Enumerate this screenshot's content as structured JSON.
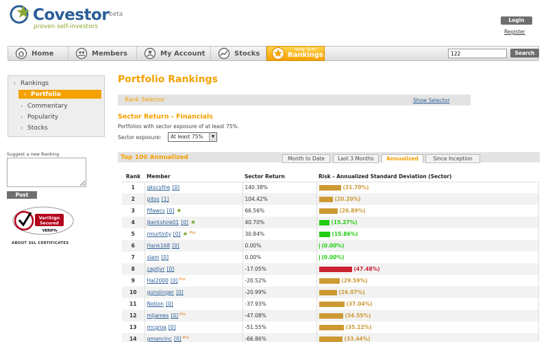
{
  "header": {
    "logo_name": "Covestor",
    "logo_beta": "beta",
    "tagline": "proven self-investors",
    "login_label": "Login",
    "register_label": "Register"
  },
  "nav": {
    "items": [
      {
        "label": "Home",
        "icon": "home-icon"
      },
      {
        "label": "Members",
        "icon": "members-icon"
      },
      {
        "label": "My Account",
        "icon": "account-icon"
      },
      {
        "label": "Stocks",
        "icon": "stocks-icon"
      }
    ],
    "rankings_label": "Rankings",
    "rankings_badge": "Now live!",
    "search_value": "122",
    "search_label": "Search"
  },
  "sidebar": {
    "items": [
      {
        "label": "Rankings",
        "active": false
      },
      {
        "label": "Portfolio",
        "active": true
      },
      {
        "label": "Commentary",
        "active": false
      },
      {
        "label": "Popularity",
        "active": false
      },
      {
        "label": "Stocks",
        "active": false
      }
    ],
    "suggest_label": "Suggest a new Ranking",
    "post_label": "Post",
    "verisign_line1": "VeriSign",
    "verisign_line2": "Secured",
    "verisign_line3": "VERIFY▸",
    "ssl_label": "ABOUT SSL CERTIFICATES"
  },
  "main": {
    "title": "Portfolio Rankings",
    "rank_selector_label": "Rank Selector",
    "show_selector_label": "Show Selector",
    "sector_title": "Sector Return - Financials",
    "sector_desc": "Portfolios with sector exposure of at least 75%.",
    "exposure_label": "Sector exposure:",
    "exposure_value": "At least 75%",
    "top_label": "Top 100 Annualized",
    "tabs": [
      {
        "label": "Month to Date",
        "active": false
      },
      {
        "label": "Last 3 Months",
        "active": false
      },
      {
        "label": "Annualized",
        "active": true
      },
      {
        "label": "Since Inception",
        "active": false
      }
    ]
  },
  "table": {
    "headers": [
      "Rank",
      "Member",
      "Sector Return",
      "Risk - Annualized Standard Deviation (Sector)"
    ],
    "colors": {
      "medium": "#cc9933",
      "low": "#22cc11",
      "high": "#cc2233"
    },
    "rows": [
      {
        "rank": "1",
        "member": "gkscythe",
        "count": "[0]",
        "star": false,
        "pro": false,
        "ret": "140.38%",
        "risk": "(31.70%)",
        "risk_value": 31.7,
        "level": "medium"
      },
      {
        "rank": "2",
        "member": "pitos",
        "count": "[1]",
        "star": false,
        "pro": false,
        "ret": "104.42%",
        "risk": "(20.20%)",
        "risk_value": 20.2,
        "level": "medium"
      },
      {
        "rank": "3",
        "member": "fifawcs",
        "count": "[0]",
        "star": true,
        "pro": false,
        "ret": "66.56%",
        "risk": "(26.89%)",
        "risk_value": 26.89,
        "level": "medium"
      },
      {
        "rank": "4",
        "member": "jberkshire01",
        "count": "[0]",
        "star": true,
        "pro": false,
        "ret": "40.70%",
        "risk": "(15.27%)",
        "risk_value": 15.27,
        "level": "low"
      },
      {
        "rank": "5",
        "member": "rmurtinty",
        "count": "[0]",
        "star": true,
        "pro": true,
        "ret": "30.84%",
        "risk": "(15.86%)",
        "risk_value": 15.86,
        "level": "low"
      },
      {
        "rank": "6",
        "member": "Hank168",
        "count": "[0]",
        "star": false,
        "pro": false,
        "ret": "0.00%",
        "risk": "(0.00%)",
        "risk_value": 0.0,
        "level": "low"
      },
      {
        "rank": "7",
        "member": "slam",
        "count": "[0]",
        "star": false,
        "pro": false,
        "ret": "0.00%",
        "risk": "(0.00%)",
        "risk_value": 0.0,
        "level": "low"
      },
      {
        "rank": "8",
        "member": "captjvr",
        "count": "[0]",
        "star": false,
        "pro": false,
        "ret": "-17.05%",
        "risk": "(47.48%)",
        "risk_value": 47.48,
        "level": "high"
      },
      {
        "rank": "9",
        "member": "Hal2000",
        "count": "[0]",
        "star": false,
        "pro": true,
        "ret": "-20.52%",
        "risk": "(29.59%)",
        "risk_value": 29.59,
        "level": "medium"
      },
      {
        "rank": "10",
        "member": "gunslinger",
        "count": "[0]",
        "star": false,
        "pro": false,
        "ret": "-20.99%",
        "risk": "(26.07%)",
        "risk_value": 26.07,
        "level": "medium"
      },
      {
        "rank": "11",
        "member": "Notion",
        "count": "[0]",
        "star": false,
        "pro": false,
        "ret": "-37.93%",
        "risk": "(37.04%)",
        "risk_value": 37.04,
        "level": "medium"
      },
      {
        "rank": "12",
        "member": "mljames",
        "count": "[0]",
        "star": false,
        "pro": true,
        "ret": "-47.08%",
        "risk": "(34.55%)",
        "risk_value": 34.55,
        "level": "medium"
      },
      {
        "rank": "13",
        "member": "mcgroa",
        "count": "[0]",
        "star": false,
        "pro": false,
        "ret": "-51.55%",
        "risk": "(35.22%)",
        "risk_value": 35.22,
        "level": "medium"
      },
      {
        "rank": "14",
        "member": "gmancinc",
        "count": "[0]",
        "star": false,
        "pro": true,
        "ret": "-66.86%",
        "risk": "(33.44%)",
        "risk_value": 33.44,
        "level": "medium"
      }
    ]
  },
  "icons": {
    "pro_mark": "Pro"
  }
}
